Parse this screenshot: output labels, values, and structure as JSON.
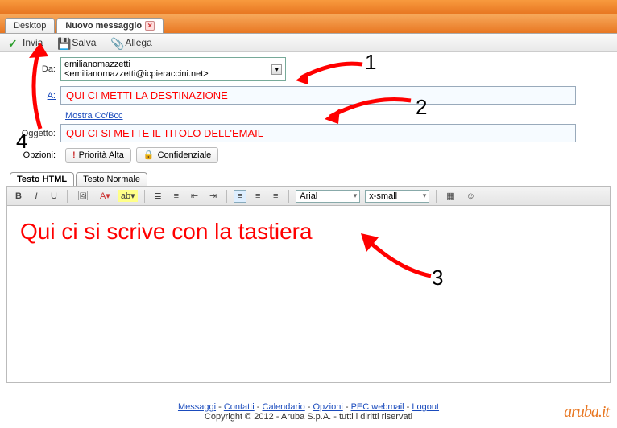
{
  "tabs": {
    "desktop": "Desktop",
    "new_message": "Nuovo messaggio"
  },
  "toolbar": {
    "send": "Invia",
    "save": "Salva",
    "attach": "Allega"
  },
  "labels": {
    "from": "Da:",
    "to": "A:",
    "subject": "Oggetto:",
    "options": "Opzioni:"
  },
  "fields": {
    "from_value": "emilianomazzetti <emilianomazzetti@icpieraccini.net>",
    "to_value": "QUI CI METTI LA DESTINAZIONE",
    "subject_value": "QUI CI SI METTE IL TITOLO DELL'EMAIL",
    "cc_link": "Mostra Cc/Bcc"
  },
  "options": {
    "priority": "Priorità Alta",
    "confidential": "Confidenziale"
  },
  "body_tabs": {
    "html": "Testo HTML",
    "plain": "Testo Normale"
  },
  "editor": {
    "font": "Arial",
    "size": "x-small",
    "body_text": "Qui ci si scrive con la tastiera"
  },
  "footer": {
    "links": [
      "Messaggi",
      "Contatti",
      "Calendario",
      "Opzioni",
      "PEC webmail",
      "Logout"
    ],
    "copyright": "Copyright © 2012 - Aruba S.p.A. - tutti i diritti riservati"
  },
  "brand": "aruba.it",
  "annotations": {
    "n1": "1",
    "n2": "2",
    "n3": "3",
    "n4": "4"
  }
}
